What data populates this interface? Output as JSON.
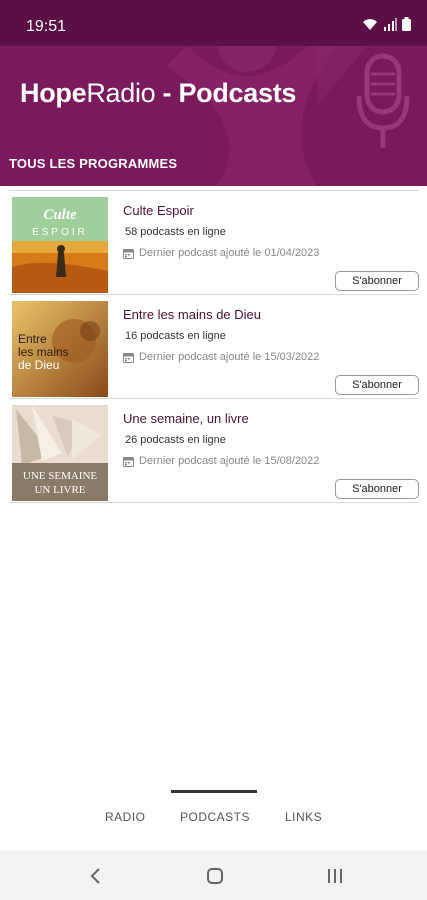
{
  "status": {
    "time": "19:51"
  },
  "header": {
    "title_bold": "Hope",
    "title_regular": "Radio",
    "title_suffix": " - Podcasts"
  },
  "section": {
    "title": "TOUS LES PROGRAMMES"
  },
  "programs": [
    {
      "title": "Culte Espoir",
      "count": "58 podcasts en ligne",
      "date": "Dernier podcast ajouté le 01/04/2023",
      "button": "S'abonner",
      "thumb_line1": "Culte",
      "thumb_line2": "ESPOIR"
    },
    {
      "title": "Entre les mains de Dieu",
      "count": "16 podcasts en ligne",
      "date": "Dernier podcast ajouté le 15/03/2022",
      "button": "S'abonner",
      "thumb_line1": "Entre",
      "thumb_line2": "les mains",
      "thumb_line3": "de Dieu"
    },
    {
      "title": "Une semaine, un livre",
      "count": "26 podcasts en ligne",
      "date": "Dernier podcast ajouté le 15/08/2022",
      "button": "S'abonner",
      "thumb_line1": "UNE SEMAINE",
      "thumb_line2": "UN LIVRE"
    }
  ],
  "tabs": [
    {
      "label": "RADIO"
    },
    {
      "label": "PODCASTS"
    },
    {
      "label": "LINKS"
    }
  ],
  "colors": {
    "header": "#7a1a5c",
    "status_bar": "#5a0f45",
    "accent_text": "#4a1238"
  }
}
